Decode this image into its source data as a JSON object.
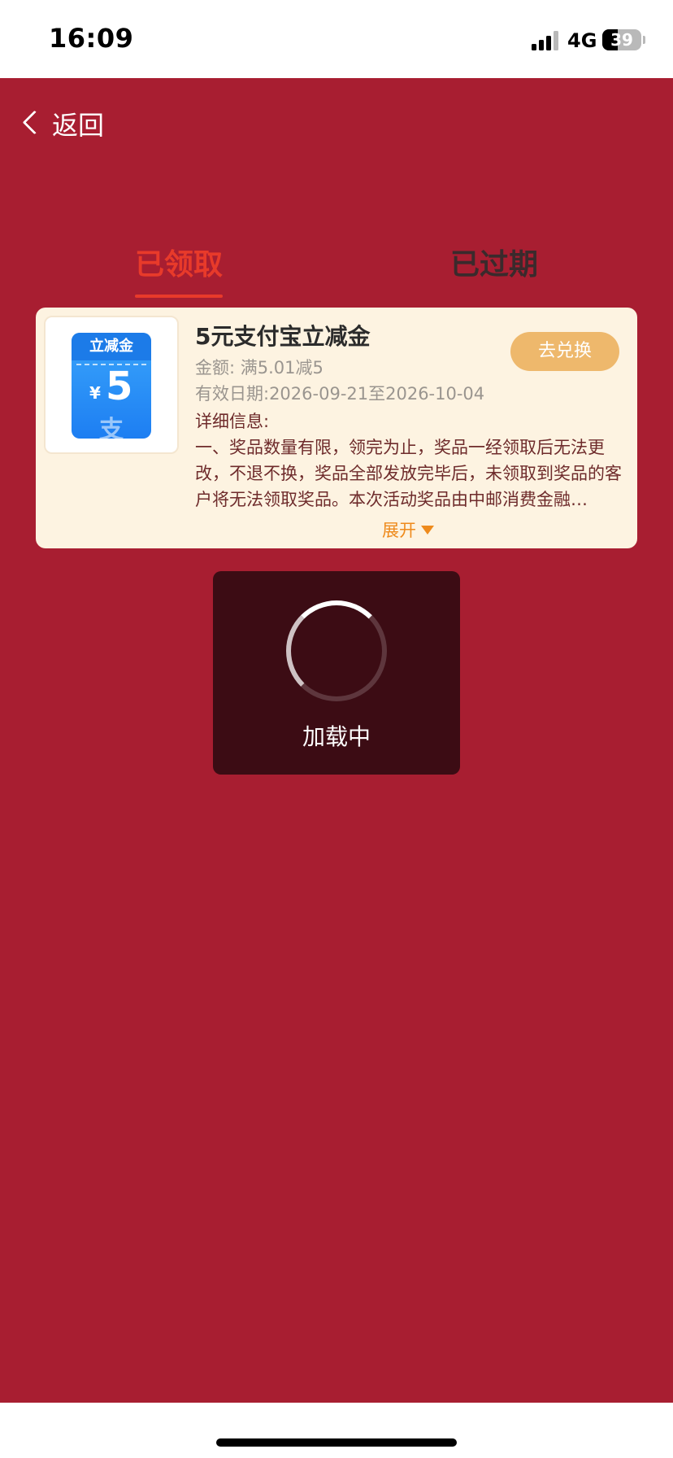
{
  "status_bar": {
    "time": "16:09",
    "network": "4G",
    "battery_level": "39",
    "battery_fraction": 0.39
  },
  "nav": {
    "back_label": "返回"
  },
  "tabs": [
    {
      "label": "已领取",
      "active": true
    },
    {
      "label": "已过期",
      "active": false
    }
  ],
  "coupon": {
    "thumb_header": "立减金",
    "thumb_currency": "¥",
    "thumb_value": "5",
    "thumb_mark": "支",
    "title": "5元支付宝立减金",
    "amount": "金额: 满5.01减5",
    "validity": "有效日期:2026-09-21至2026-10-04",
    "redeem_label": "去兑换",
    "detail_label": "详细信息:",
    "detail_text": "一、奖品数量有限，领完为止，奖品一经领取后无法更改，不退不换，奖品全部发放完毕后，未领取到奖品的客户将无法领取奖品。本次活动奖品由中邮消费金融…",
    "expand_label": "展开"
  },
  "loading": {
    "text": "加载中"
  },
  "colors": {
    "background_red": "#a81e31",
    "active_tab": "#e83a2a",
    "card_bg": "#fdf3e1",
    "redeem_button": "#eeb86c",
    "expand": "#ee8a1c",
    "loading_bg": "#3c0c14"
  },
  "icons": {
    "back": "chevron-left-icon",
    "expand": "triangle-down-icon",
    "spinner": "loading-spinner-icon"
  }
}
